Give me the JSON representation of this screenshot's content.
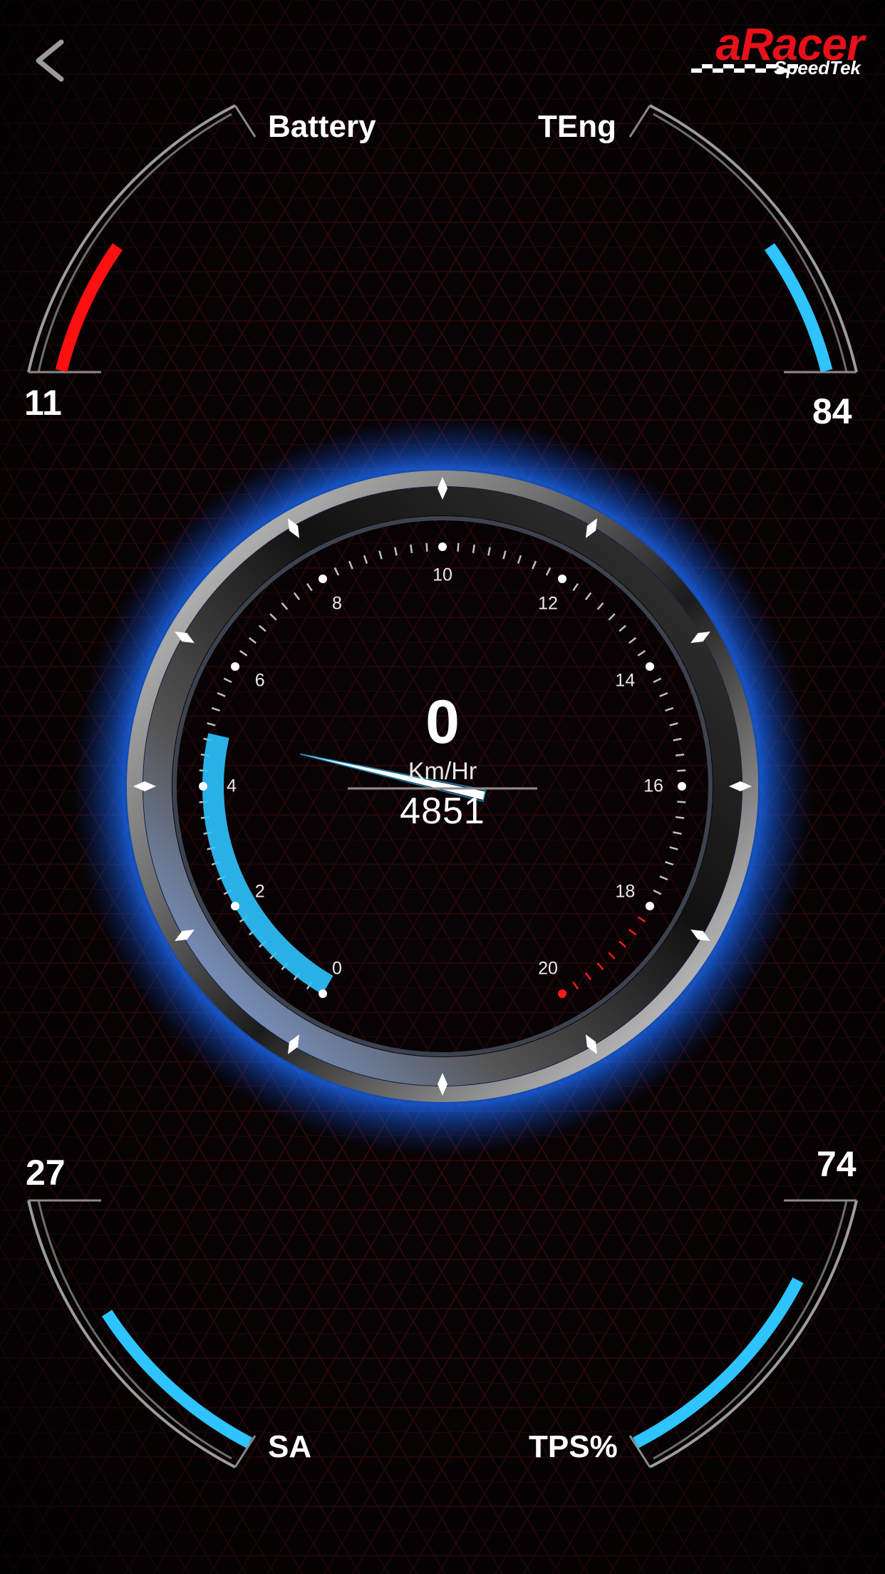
{
  "header": {
    "back_icon": "chevron-left-icon",
    "brand": "aRacer",
    "brand_sub": "SpeedTek",
    "brand_color": "#e8101a"
  },
  "gauges": {
    "battery": {
      "label": "Battery",
      "value": "11",
      "fill": 0.45,
      "color": "#ff1010"
    },
    "teng": {
      "label": "TEng",
      "value": "84",
      "fill": 0.45,
      "color": "#2ec4ff"
    },
    "sa": {
      "label": "SA",
      "value": "27",
      "fill": 0.55,
      "color": "#2ec4ff"
    },
    "tps": {
      "label": "TPS%",
      "value": "74",
      "fill": 0.75,
      "color": "#2ec4ff"
    }
  },
  "tachometer": {
    "speed": "0",
    "unit": "Km/Hr",
    "rpm": "4851",
    "scale_labels": [
      "0",
      "2",
      "4",
      "6",
      "8",
      "10",
      "12",
      "14",
      "16",
      "18",
      "20"
    ],
    "scale_max": 20,
    "needle_value": 4.851,
    "redline_from": 18,
    "accent_color": "#2ec4ff",
    "redline_color": "#ff1a1a"
  }
}
